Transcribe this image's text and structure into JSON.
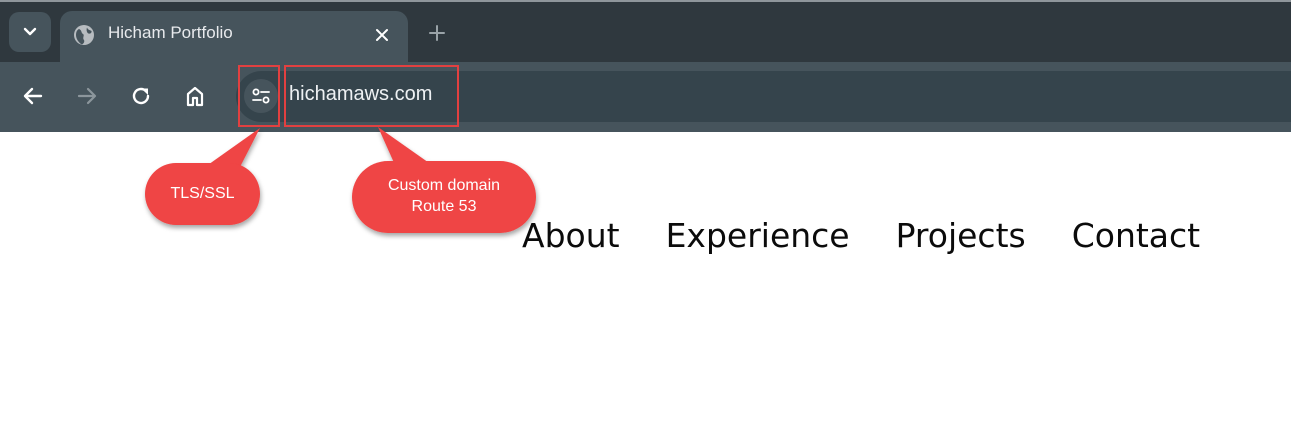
{
  "browser": {
    "tab": {
      "title": "Hicham Portfolio"
    },
    "omnibox": {
      "url": "hichamaws.com"
    }
  },
  "annotations": {
    "tls": {
      "label": "TLS/SSL"
    },
    "domain": {
      "line1": "Custom domain",
      "line2": "Route 53"
    },
    "color": "#ef4444"
  },
  "page": {
    "nav": [
      "About",
      "Experience",
      "Projects",
      "Contact"
    ]
  },
  "icons": {
    "tab_search": "chevron-down-icon",
    "favicon": "globe-icon",
    "tab_close": "close-icon",
    "new_tab": "plus-icon",
    "back": "arrow-left-icon",
    "forward": "arrow-right-icon",
    "reload": "reload-icon",
    "home": "home-icon",
    "site_info": "tune-icon"
  },
  "colors": {
    "tabstrip": "#2f383e",
    "toolbar": "#46545c",
    "omnibox": "#35444c",
    "annotation": "#ef4444",
    "highlight_border": "#e24040"
  }
}
